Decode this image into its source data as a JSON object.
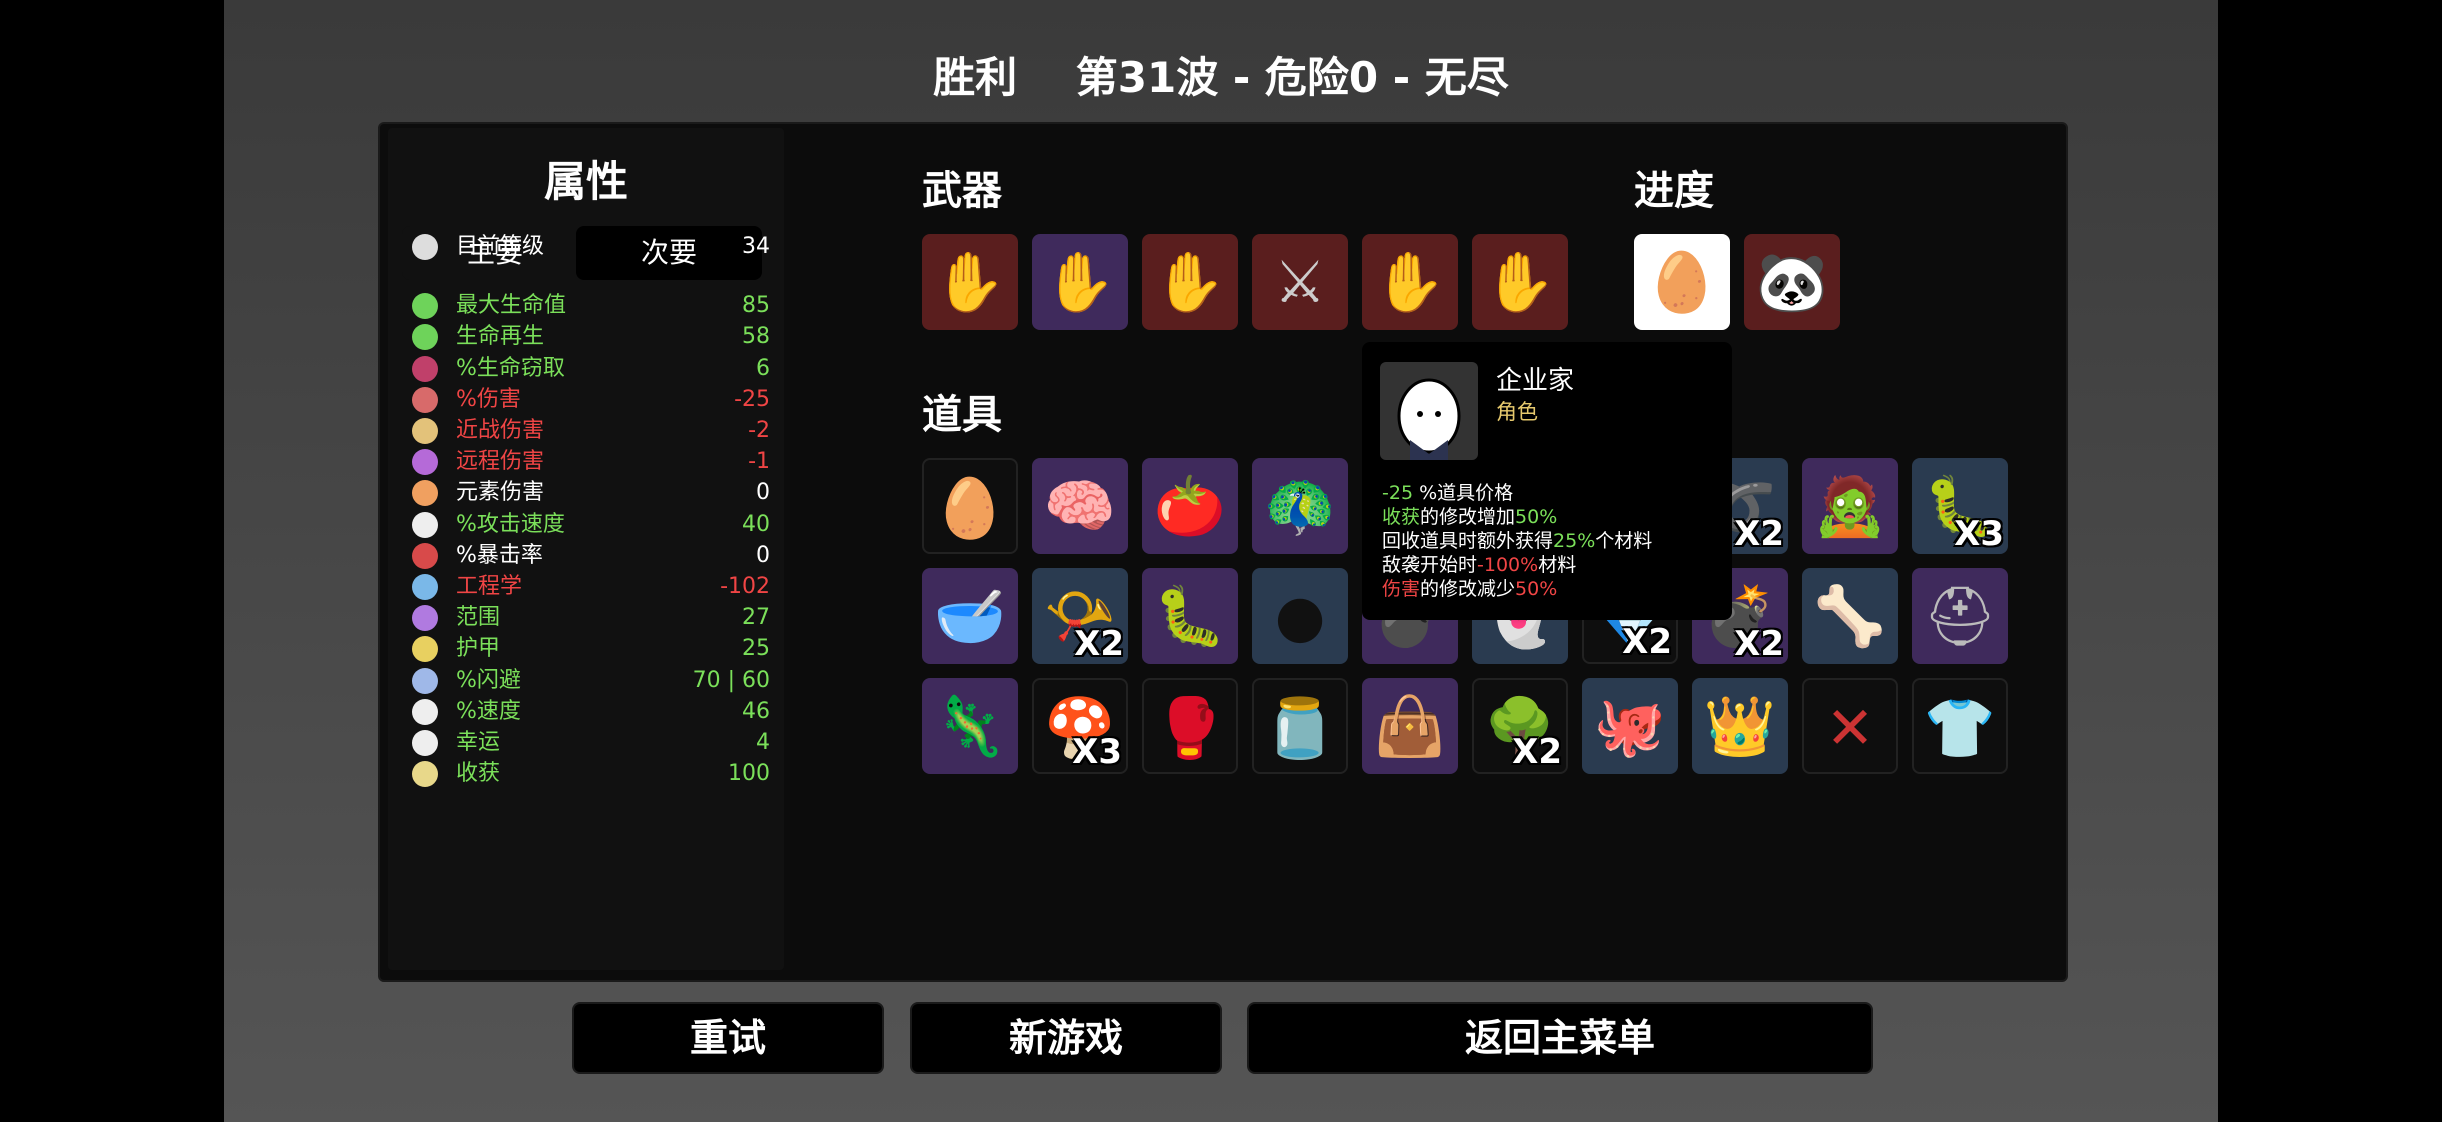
{
  "header": {
    "result": "胜利",
    "wave_info": "第31波 - 危险0 - 无尽"
  },
  "stats": {
    "title": "属性",
    "tabs": {
      "main": "主要",
      "secondary": "次要"
    },
    "rows": [
      {
        "label": "目前等级",
        "value": "34",
        "label_color": "white",
        "value_color": "white",
        "icon": "level-icon"
      },
      {
        "label": "最大生命值",
        "value": "85",
        "label_color": "green",
        "value_color": "green",
        "icon": "heart-icon"
      },
      {
        "label": "生命再生",
        "value": "58",
        "label_color": "green",
        "value_color": "green",
        "icon": "regen-icon"
      },
      {
        "label": "%生命窃取",
        "value": "6",
        "label_color": "green",
        "value_color": "green",
        "icon": "lifesteal-icon"
      },
      {
        "label": "%伤害",
        "value": "-25",
        "label_color": "red",
        "value_color": "red",
        "icon": "damage-icon"
      },
      {
        "label": "近战伤害",
        "value": "-2",
        "label_color": "red",
        "value_color": "red",
        "icon": "melee-icon"
      },
      {
        "label": "远程伤害",
        "value": "-1",
        "label_color": "red",
        "value_color": "red",
        "icon": "ranged-icon"
      },
      {
        "label": "元素伤害",
        "value": "0",
        "label_color": "white",
        "value_color": "white",
        "icon": "elemental-icon"
      },
      {
        "label": "%攻击速度",
        "value": "40",
        "label_color": "green",
        "value_color": "green",
        "icon": "attack-speed-icon"
      },
      {
        "label": "%暴击率",
        "value": "0",
        "label_color": "white",
        "value_color": "white",
        "icon": "crit-icon"
      },
      {
        "label": "工程学",
        "value": "-102",
        "label_color": "red",
        "value_color": "red",
        "icon": "engineering-icon"
      },
      {
        "label": "范围",
        "value": "27",
        "label_color": "green",
        "value_color": "green",
        "icon": "range-icon"
      },
      {
        "label": "护甲",
        "value": "25",
        "label_color": "green",
        "value_color": "green",
        "icon": "armor-icon"
      },
      {
        "label": "%闪避",
        "value": "70 | 60",
        "label_color": "green",
        "value_color": "green",
        "icon": "dodge-icon"
      },
      {
        "label": "%速度",
        "value": "46",
        "label_color": "green",
        "value_color": "green",
        "icon": "speed-icon"
      },
      {
        "label": "幸运",
        "value": "4",
        "label_color": "green",
        "value_color": "green",
        "icon": "luck-icon"
      },
      {
        "label": "收获",
        "value": "100",
        "label_color": "green",
        "value_color": "green",
        "icon": "harvest-icon"
      }
    ]
  },
  "weapons": {
    "title": "武器",
    "items": [
      {
        "icon": "hand-icon",
        "tier": "red"
      },
      {
        "icon": "hand-icon",
        "tier": "purple"
      },
      {
        "icon": "hand-icon",
        "tier": "red"
      },
      {
        "icon": "spear-icon",
        "tier": "red"
      },
      {
        "icon": "hand-icon",
        "tier": "red"
      },
      {
        "icon": "hand-icon",
        "tier": "red"
      }
    ]
  },
  "progress": {
    "title": "进度",
    "items": [
      {
        "icon": "egg-character-icon",
        "tier": "white"
      },
      {
        "icon": "panda-icon",
        "tier": "red"
      }
    ]
  },
  "items": {
    "title": "道具",
    "grid": [
      {
        "icon": "egg-face-icon",
        "tier": "black",
        "count": ""
      },
      {
        "icon": "brain-icon",
        "tier": "purple",
        "count": ""
      },
      {
        "icon": "tomato-icon",
        "tier": "purple",
        "count": ""
      },
      {
        "icon": "peacock-icon",
        "tier": "purple",
        "count": ""
      },
      {
        "icon": "hidden-item-icon",
        "tier": "black",
        "count": ""
      },
      {
        "icon": "hidden-item-icon",
        "tier": "black",
        "count": ""
      },
      {
        "icon": "hidden-item-icon",
        "tier": "black",
        "count": ""
      },
      {
        "icon": "rope-icon",
        "tier": "blue",
        "count": "X2"
      },
      {
        "icon": "zombie-icon",
        "tier": "purple",
        "count": ""
      },
      {
        "icon": "cocoon-icon",
        "tier": "blue",
        "count": "X3"
      },
      {
        "icon": "mortar-icon",
        "tier": "purple",
        "count": ""
      },
      {
        "icon": "horn-icon",
        "tier": "blue",
        "count": "X2"
      },
      {
        "icon": "tardigrade-icon",
        "tier": "purple",
        "count": ""
      },
      {
        "icon": "seeds-icon",
        "tier": "blue",
        "count": ""
      },
      {
        "icon": "cannon-icon",
        "tier": "purple",
        "count": ""
      },
      {
        "icon": "ghost-icon",
        "tier": "blue",
        "count": ""
      },
      {
        "icon": "gem-icon",
        "tier": "black",
        "count": "X2"
      },
      {
        "icon": "bomb-icon",
        "tier": "purple",
        "count": "X2"
      },
      {
        "icon": "bone-icon",
        "tier": "blue",
        "count": ""
      },
      {
        "icon": "helmet-icon",
        "tier": "purple",
        "count": ""
      },
      {
        "icon": "chameleon-icon",
        "tier": "purple",
        "count": ""
      },
      {
        "icon": "mushroom-icon",
        "tier": "black",
        "count": "X3"
      },
      {
        "icon": "glove-icon",
        "tier": "black",
        "count": ""
      },
      {
        "icon": "jar-icon",
        "tier": "black",
        "count": ""
      },
      {
        "icon": "bag-icon",
        "tier": "purple",
        "count": ""
      },
      {
        "icon": "tree-icon",
        "tier": "black",
        "count": "X2"
      },
      {
        "icon": "tentacle-icon",
        "tier": "blue",
        "count": ""
      },
      {
        "icon": "crown-icon",
        "tier": "blue",
        "count": ""
      },
      {
        "icon": "barbed-wire-icon",
        "tier": "black",
        "count": ""
      },
      {
        "icon": "shirt-icon",
        "tier": "black",
        "count": ""
      }
    ]
  },
  "tooltip": {
    "name": "企业家",
    "type": "角色",
    "lines": [
      [
        {
          "t": "-25",
          "c": "green"
        },
        {
          "t": " %道具价格",
          "c": "white"
        }
      ],
      [
        {
          "t": "收获",
          "c": "green"
        },
        {
          "t": "的修改增加",
          "c": "white"
        },
        {
          "t": "50%",
          "c": "green"
        }
      ],
      [
        {
          "t": "回收道具时额外获得",
          "c": "white"
        },
        {
          "t": "25%",
          "c": "green"
        },
        {
          "t": "个材料",
          "c": "white"
        }
      ],
      [
        {
          "t": "敌袭开始时",
          "c": "white"
        },
        {
          "t": "-100%",
          "c": "red"
        },
        {
          "t": "材料",
          "c": "white"
        }
      ],
      [
        {
          "t": "伤害",
          "c": "red"
        },
        {
          "t": "的修改减少",
          "c": "white"
        },
        {
          "t": "50%",
          "c": "red"
        }
      ]
    ]
  },
  "buttons": {
    "retry": "重试",
    "new_game": "新游戏",
    "main_menu": "返回主菜单"
  }
}
